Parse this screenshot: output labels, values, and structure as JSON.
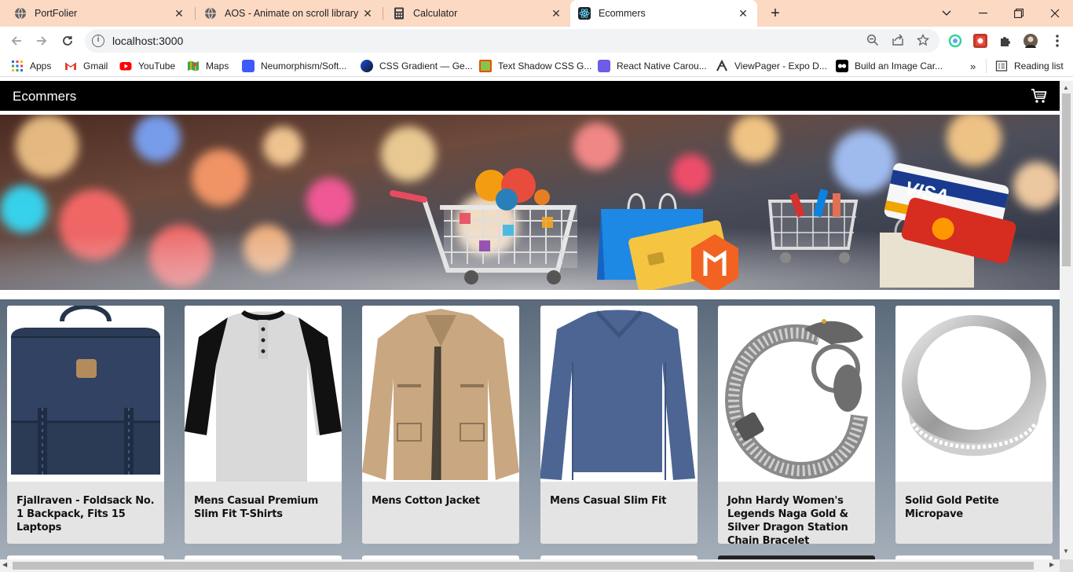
{
  "tabs": [
    {
      "title": "PortFolier",
      "icon": "globe-icon"
    },
    {
      "title": "AOS - Animate on scroll library",
      "icon": "globe-icon"
    },
    {
      "title": "Calculator",
      "icon": "calculator-icon"
    },
    {
      "title": "Ecommers",
      "icon": "react-icon",
      "active": true
    }
  ],
  "address_bar": {
    "url": "localhost:3000"
  },
  "bookmarks": [
    {
      "label": "Apps",
      "icon": "apps-grid-icon"
    },
    {
      "label": "Gmail",
      "icon": "gmail-icon"
    },
    {
      "label": "YouTube",
      "icon": "youtube-icon"
    },
    {
      "label": "Maps",
      "icon": "maps-icon"
    },
    {
      "label": "Neumorphism/Soft...",
      "icon": "bookmark-icon"
    },
    {
      "label": "CSS Gradient — Ge...",
      "icon": "bookmark-icon"
    },
    {
      "label": "Text Shadow CSS G...",
      "icon": "bookmark-icon"
    },
    {
      "label": "React Native Carou...",
      "icon": "bookmark-icon"
    },
    {
      "label": "ViewPager - Expo D...",
      "icon": "bookmark-icon"
    },
    {
      "label": "Build an Image Car...",
      "icon": "bookmark-icon"
    }
  ],
  "reading_list": "Reading list",
  "app": {
    "brand": "Ecommers",
    "cart_icon": "cart-icon"
  },
  "banner": {
    "image": "ecommerce-shopping-banner"
  },
  "products": [
    {
      "name": "Fjallraven - Foldsack No. 1 Backpack, Fits 15 Laptops",
      "image": "backpack"
    },
    {
      "name": "Mens Casual Premium Slim Fit T-Shirts",
      "image": "raglan-tshirt"
    },
    {
      "name": "Mens Cotton Jacket",
      "image": "cotton-jacket"
    },
    {
      "name": "Mens Casual Slim Fit",
      "image": "long-sleeve-shirt"
    },
    {
      "name": "John Hardy Women's Legends Naga Gold & Silver Dragon Station Chain Bracelet",
      "image": "dragon-bracelet"
    },
    {
      "name": "Solid Gold Petite Micropave",
      "image": "silver-ring"
    }
  ],
  "colors": {
    "tabstrip": "#fcd9c3",
    "appbar": "#000000",
    "card": "#e4e4e4"
  }
}
